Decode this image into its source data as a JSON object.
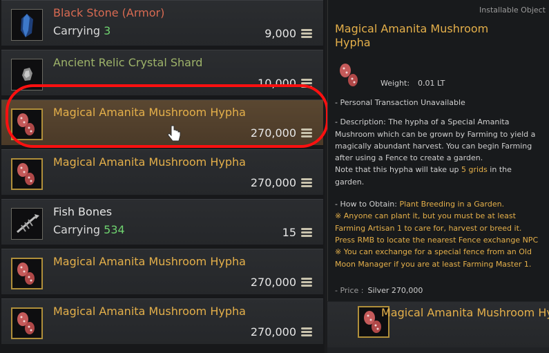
{
  "items": [
    {
      "name": "Black Stone (Armor)",
      "carrying_label": "Carrying",
      "carrying_count": "3",
      "price": "9,000",
      "icon": "black-stone-icon"
    },
    {
      "name": "Ancient Relic Crystal Shard",
      "price": "10,000",
      "icon": "crystal-shard-icon"
    },
    {
      "name": "Magical Amanita Mushroom Hypha",
      "price": "270,000",
      "icon": "mushroom-hypha-icon"
    },
    {
      "name": "Magical Amanita Mushroom Hypha",
      "price": "270,000",
      "icon": "mushroom-hypha-icon"
    },
    {
      "name": "Fish Bones",
      "carrying_label": "Carrying",
      "carrying_count": "534",
      "price": "15",
      "icon": "fish-bones-icon"
    },
    {
      "name": "Magical Amanita Mushroom Hypha",
      "price": "270,000",
      "icon": "mushroom-hypha-icon"
    },
    {
      "name": "Magical Amanita Mushroom Hypha",
      "price": "270,000",
      "icon": "mushroom-hypha-icon"
    }
  ],
  "tooltip": {
    "category": "Installable Object",
    "title": "Magical Amanita Mushroom Hypha",
    "weight_label": "Weight:",
    "weight_value": "0.01 LT",
    "line_transaction": "- Personal Transaction Unavailable",
    "desc1": "- Description: The hypha of a Special Amanita Mushroom which can be grown by Farming to yield a magically abundant harvest. You can begin Farming after using a Fence to create a garden.",
    "desc2_pre": "Note that this hypha will take up ",
    "desc2_highlight": "5 grids",
    "desc2_post": " in the garden.",
    "obtain_label": "- How to Obtain: ",
    "obtain_value": "Plant Breeding in a Garden.",
    "note1": "※ Anyone can plant it, but you must be at least Farming Artisan 1 to care for, harvest or breed it. Press RMB to locate the nearest Fence exchange NPC",
    "note2": "※ You can exchange for a special fence from an Old Moon Manager if you are at least Farming Master 1.",
    "price_label": "- Price :",
    "price_value": "Silver 270,000"
  },
  "bottom_item": {
    "name": "Magical Amanita Mushroom Hy"
  },
  "colors": {
    "orange": "#d86a52",
    "olive": "#9eb46a",
    "gold": "#e5b04a",
    "green": "#6fd36f",
    "highlight": "#ff1010"
  }
}
